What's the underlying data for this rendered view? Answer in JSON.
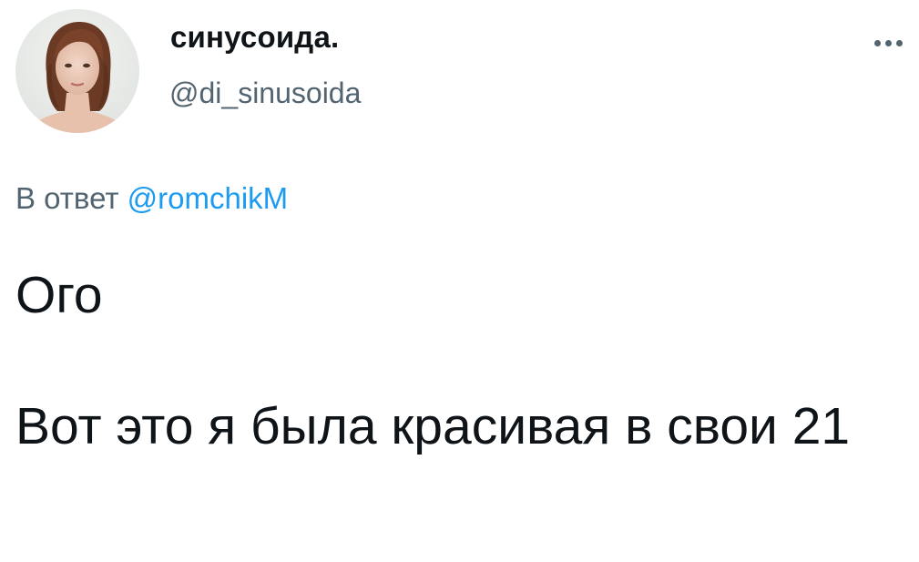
{
  "author": {
    "display_name": "синусоида.",
    "handle": "@di_sinusoida",
    "avatar_icon": "user-avatar-photo"
  },
  "menu": {
    "icon": "more-horizontal-icon"
  },
  "reply": {
    "prefix": "В ответ",
    "mention": "@romchikM"
  },
  "tweet": {
    "line1": "Ого",
    "line2": "Вот это я была красивая в свои 21"
  },
  "colors": {
    "text_primary": "#0f1419",
    "text_secondary": "#536471",
    "link": "#1d9bf0",
    "background": "#ffffff"
  }
}
